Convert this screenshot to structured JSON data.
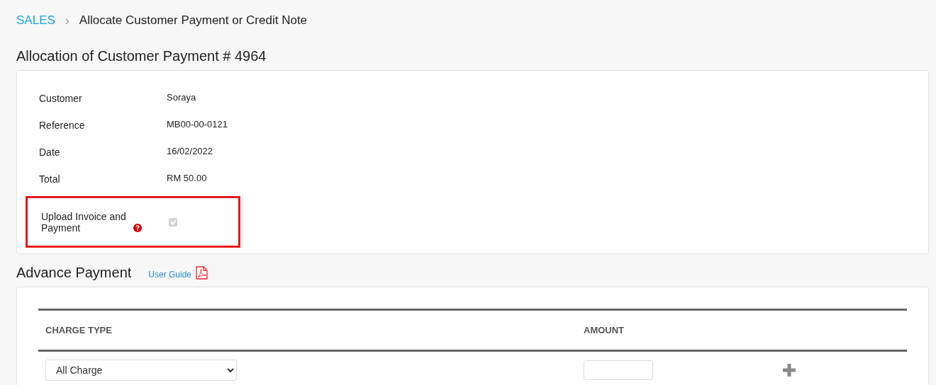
{
  "breadcrumb": {
    "section": "SALES",
    "separator": "›",
    "page": "Allocate Customer Payment or Credit Note"
  },
  "allocation": {
    "title": "Allocation of Customer Payment # 4964",
    "details": [
      {
        "label": "Customer",
        "value": "Soraya"
      },
      {
        "label": "Reference",
        "value": "MB00-00-0121"
      },
      {
        "label": "Date",
        "value": "16/02/2022"
      },
      {
        "label": "Total",
        "value": "RM 50.00"
      }
    ],
    "upload": {
      "label": "Upload Invoice and Payment",
      "checked": true,
      "disabled": true,
      "highlighted": true
    }
  },
  "advance_payment": {
    "title": "Advance Payment",
    "guide_link": "User Guide",
    "columns": [
      "CHARGE TYPE",
      "AMOUNT"
    ],
    "rows": [
      {
        "charge_type": "All Charge"
      }
    ]
  }
}
